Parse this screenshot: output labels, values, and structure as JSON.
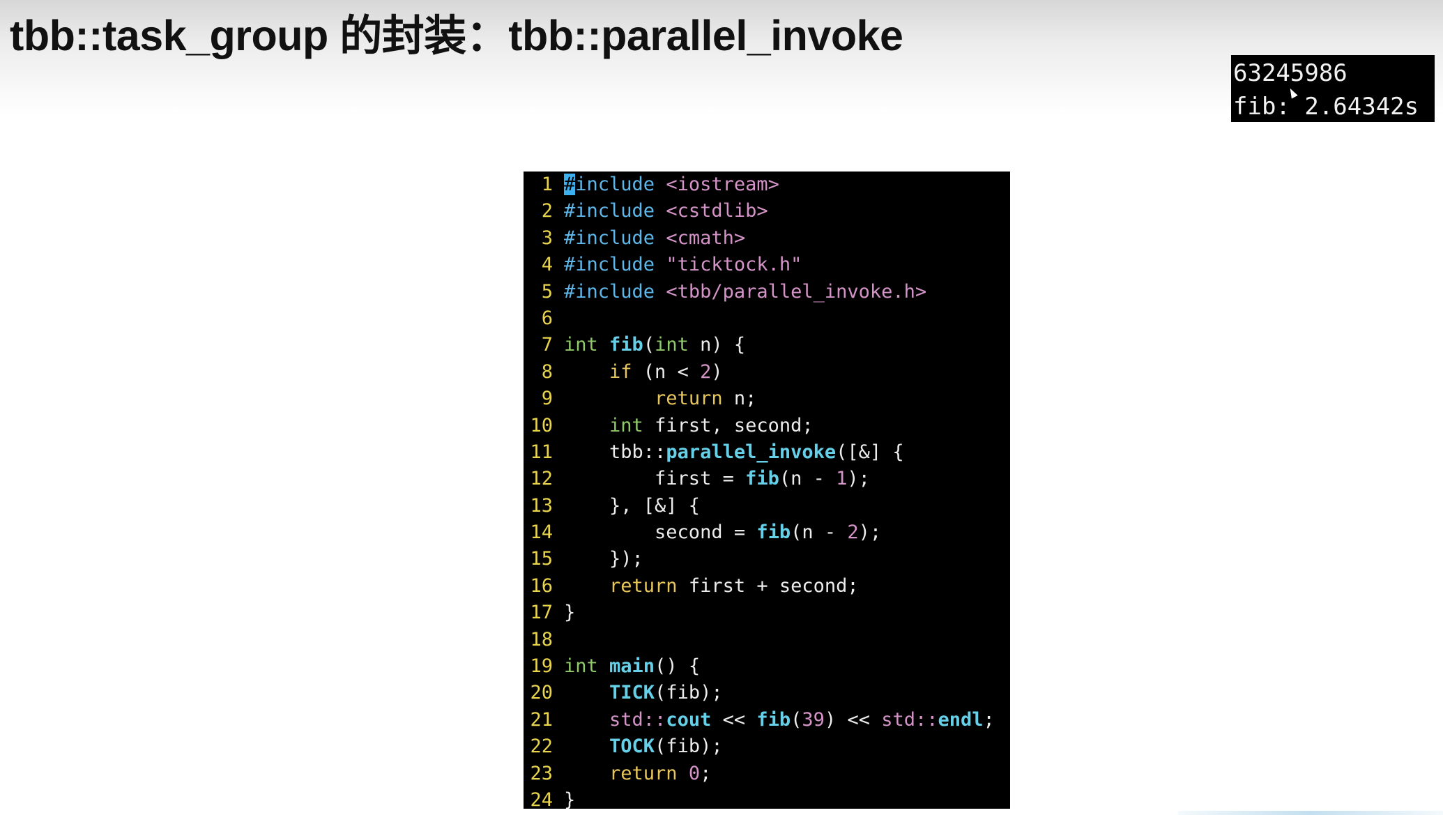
{
  "slide": {
    "title": "tbb::task_group 的封装：tbb::parallel_invoke"
  },
  "output_terminal": {
    "lines": [
      "63245986",
      "fib: 2.64342s"
    ]
  },
  "editor": {
    "lines": [
      {
        "num": "1",
        "tokens": [
          {
            "c": "cursor-block",
            "t": "#"
          },
          {
            "c": "tok-pre",
            "t": "include "
          },
          {
            "c": "tok-inc",
            "t": "<iostream>"
          }
        ]
      },
      {
        "num": "2",
        "tokens": [
          {
            "c": "tok-pre",
            "t": "#include "
          },
          {
            "c": "tok-inc",
            "t": "<cstdlib>"
          }
        ]
      },
      {
        "num": "3",
        "tokens": [
          {
            "c": "tok-pre",
            "t": "#include "
          },
          {
            "c": "tok-inc",
            "t": "<cmath>"
          }
        ]
      },
      {
        "num": "4",
        "tokens": [
          {
            "c": "tok-pre",
            "t": "#include "
          },
          {
            "c": "tok-inc",
            "t": "\"ticktock.h\""
          }
        ]
      },
      {
        "num": "5",
        "tokens": [
          {
            "c": "tok-pre",
            "t": "#include "
          },
          {
            "c": "tok-inc",
            "t": "<tbb/parallel_invoke.h>"
          }
        ]
      },
      {
        "num": "6",
        "tokens": []
      },
      {
        "num": "7",
        "tokens": [
          {
            "c": "tok-type",
            "t": "int "
          },
          {
            "c": "tok-fn",
            "t": "fib"
          },
          {
            "c": "tok-plain",
            "t": "("
          },
          {
            "c": "tok-type",
            "t": "int"
          },
          {
            "c": "tok-plain",
            "t": " n) {"
          }
        ]
      },
      {
        "num": "8",
        "tokens": [
          {
            "c": "tok-plain",
            "t": "    "
          },
          {
            "c": "tok-kw",
            "t": "if"
          },
          {
            "c": "tok-plain",
            "t": " (n < "
          },
          {
            "c": "tok-num",
            "t": "2"
          },
          {
            "c": "tok-plain",
            "t": ")"
          }
        ]
      },
      {
        "num": "9",
        "tokens": [
          {
            "c": "tok-plain",
            "t": "        "
          },
          {
            "c": "tok-kw",
            "t": "return"
          },
          {
            "c": "tok-plain",
            "t": " n;"
          }
        ]
      },
      {
        "num": "10",
        "tokens": [
          {
            "c": "tok-plain",
            "t": "    "
          },
          {
            "c": "tok-type",
            "t": "int"
          },
          {
            "c": "tok-plain",
            "t": " first, second;"
          }
        ]
      },
      {
        "num": "11",
        "tokens": [
          {
            "c": "tok-plain",
            "t": "    tbb::"
          },
          {
            "c": "tok-fn",
            "t": "parallel_invoke"
          },
          {
            "c": "tok-plain",
            "t": "([&] {"
          }
        ]
      },
      {
        "num": "12",
        "tokens": [
          {
            "c": "tok-plain",
            "t": "        first = "
          },
          {
            "c": "tok-fn",
            "t": "fib"
          },
          {
            "c": "tok-plain",
            "t": "(n - "
          },
          {
            "c": "tok-num",
            "t": "1"
          },
          {
            "c": "tok-plain",
            "t": ");"
          }
        ]
      },
      {
        "num": "13",
        "tokens": [
          {
            "c": "tok-plain",
            "t": "    }, [&] {"
          }
        ]
      },
      {
        "num": "14",
        "tokens": [
          {
            "c": "tok-plain",
            "t": "        second = "
          },
          {
            "c": "tok-fn",
            "t": "fib"
          },
          {
            "c": "tok-plain",
            "t": "(n - "
          },
          {
            "c": "tok-num",
            "t": "2"
          },
          {
            "c": "tok-plain",
            "t": ");"
          }
        ]
      },
      {
        "num": "15",
        "tokens": [
          {
            "c": "tok-plain",
            "t": "    });"
          }
        ]
      },
      {
        "num": "16",
        "tokens": [
          {
            "c": "tok-plain",
            "t": "    "
          },
          {
            "c": "tok-kw",
            "t": "return"
          },
          {
            "c": "tok-plain",
            "t": " first + second;"
          }
        ]
      },
      {
        "num": "17",
        "tokens": [
          {
            "c": "tok-plain",
            "t": "}"
          }
        ]
      },
      {
        "num": "18",
        "tokens": []
      },
      {
        "num": "19",
        "tokens": [
          {
            "c": "tok-type",
            "t": "int "
          },
          {
            "c": "tok-fn",
            "t": "main"
          },
          {
            "c": "tok-plain",
            "t": "() {"
          }
        ]
      },
      {
        "num": "20",
        "tokens": [
          {
            "c": "tok-plain",
            "t": "    "
          },
          {
            "c": "tok-fn",
            "t": "TICK"
          },
          {
            "c": "tok-plain",
            "t": "(fib);"
          }
        ]
      },
      {
        "num": "21",
        "tokens": [
          {
            "c": "tok-plain",
            "t": "    "
          },
          {
            "c": "tok-ns",
            "t": "std::"
          },
          {
            "c": "tok-fn",
            "t": "cout"
          },
          {
            "c": "tok-plain",
            "t": " << "
          },
          {
            "c": "tok-fn",
            "t": "fib"
          },
          {
            "c": "tok-plain",
            "t": "("
          },
          {
            "c": "tok-num",
            "t": "39"
          },
          {
            "c": "tok-plain",
            "t": ") << "
          },
          {
            "c": "tok-ns",
            "t": "std::"
          },
          {
            "c": "tok-fn",
            "t": "endl"
          },
          {
            "c": "tok-plain",
            "t": ";"
          }
        ]
      },
      {
        "num": "22",
        "tokens": [
          {
            "c": "tok-plain",
            "t": "    "
          },
          {
            "c": "tok-fn",
            "t": "TOCK"
          },
          {
            "c": "tok-plain",
            "t": "(fib);"
          }
        ]
      },
      {
        "num": "23",
        "tokens": [
          {
            "c": "tok-plain",
            "t": "    "
          },
          {
            "c": "tok-kw",
            "t": "return"
          },
          {
            "c": "tok-plain",
            "t": " "
          },
          {
            "c": "tok-num",
            "t": "0"
          },
          {
            "c": "tok-plain",
            "t": ";"
          }
        ]
      },
      {
        "num": "24",
        "tokens": [
          {
            "c": "tok-plain",
            "t": "}"
          }
        ]
      }
    ]
  },
  "colors": {
    "line_number": "#e8d44d",
    "preprocessor": "#5fb6e8",
    "include_path": "#d494c8",
    "type": "#8fc96a",
    "keyword": "#e7c65c",
    "function": "#66d0e8",
    "number": "#d494c8",
    "cursor": "#3db0f0",
    "editor_background": "#000000"
  }
}
